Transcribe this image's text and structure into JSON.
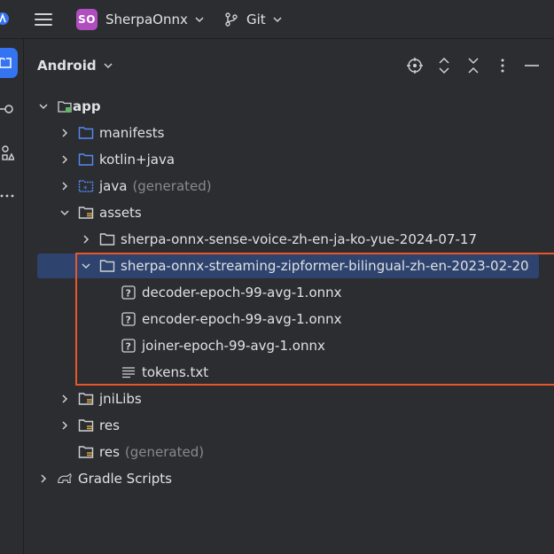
{
  "titlebar": {
    "project_badge": "SO",
    "project_name": "SherpaOnnx",
    "vcs_name": "Git"
  },
  "panel": {
    "title": "Android"
  },
  "tree": {
    "app": "app",
    "manifests": "manifests",
    "kotlin_java": "kotlin+java",
    "java_generated": "java",
    "java_generated_suffix": "(generated)",
    "assets": "assets",
    "sense_voice": "sherpa-onnx-sense-voice-zh-en-ja-ko-yue-2024-07-17",
    "streaming_zipformer": "sherpa-onnx-streaming-zipformer-bilingual-zh-en-2023-02-20",
    "decoder": "decoder-epoch-99-avg-1.onnx",
    "encoder": "encoder-epoch-99-avg-1.onnx",
    "joiner": "joiner-epoch-99-avg-1.onnx",
    "tokens": "tokens.txt",
    "jnilibs": "jniLibs",
    "res": "res",
    "res_generated": "res",
    "res_generated_suffix": "(generated)",
    "gradle_scripts": "Gradle Scripts"
  },
  "colors": {
    "background": "#2b2d30",
    "selection": "#2e436e",
    "highlight_box": "#e8562a",
    "folder": "#548af7",
    "project_badge": "#b04ec0",
    "accent": "#3574f0"
  }
}
